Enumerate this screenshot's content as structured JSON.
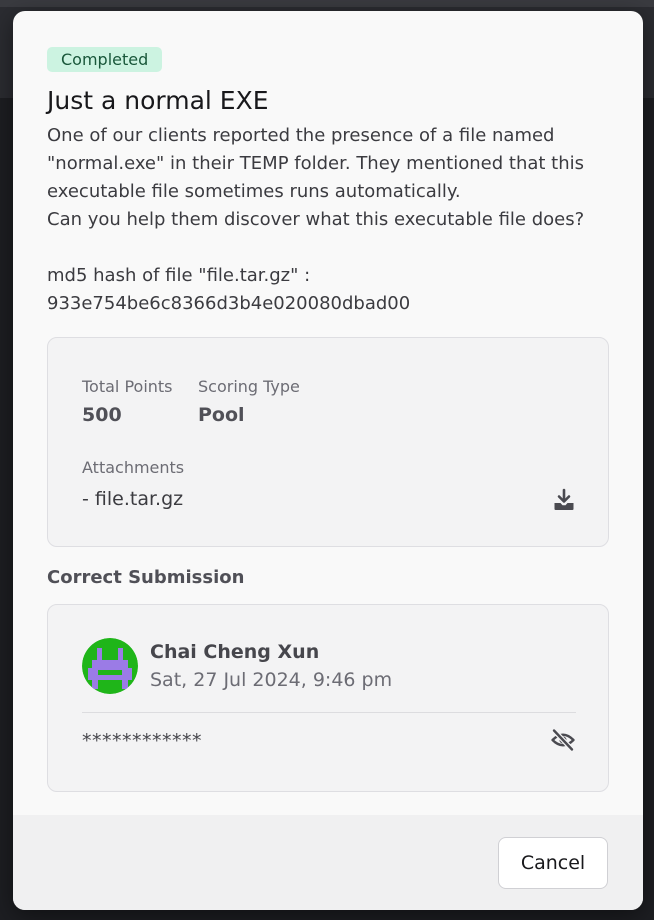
{
  "challenge": {
    "status_badge": "Completed",
    "title": "Just a normal EXE",
    "description_lines": [
      "One of our clients reported the presence of a file named",
      "\"normal.exe\" in their TEMP folder. They mentioned that this",
      "executable file sometimes runs automatically.",
      "Can you help them discover what this executable file does?"
    ],
    "hash_label": "md5 hash of file \"file.tar.gz\" :",
    "hash_value": "933e754be6c8366d3b4e020080dbad00"
  },
  "details": {
    "total_points_label": "Total Points",
    "total_points_value": "500",
    "scoring_type_label": "Scoring Type",
    "scoring_type_value": "Pool",
    "attachments_label": "Attachments",
    "attachment_file": "- file.tar.gz",
    "download_icon": "download-icon"
  },
  "submission": {
    "section_title": "Correct Submission",
    "user_name": "Chai Cheng Xun",
    "timestamp": "Sat, 27 Jul 2024, 9:46 pm",
    "masked_flag": "************",
    "reveal_icon": "eye-slash-icon",
    "avatar_colors": {
      "background": "#1fb519",
      "figure": "#9b7be6"
    }
  },
  "footer": {
    "cancel_label": "Cancel"
  },
  "colors": {
    "badge_bg": "#ccf3e1",
    "badge_text": "#19573a",
    "modal_bg": "#f9f9f9",
    "card_bg": "#f3f3f4"
  }
}
